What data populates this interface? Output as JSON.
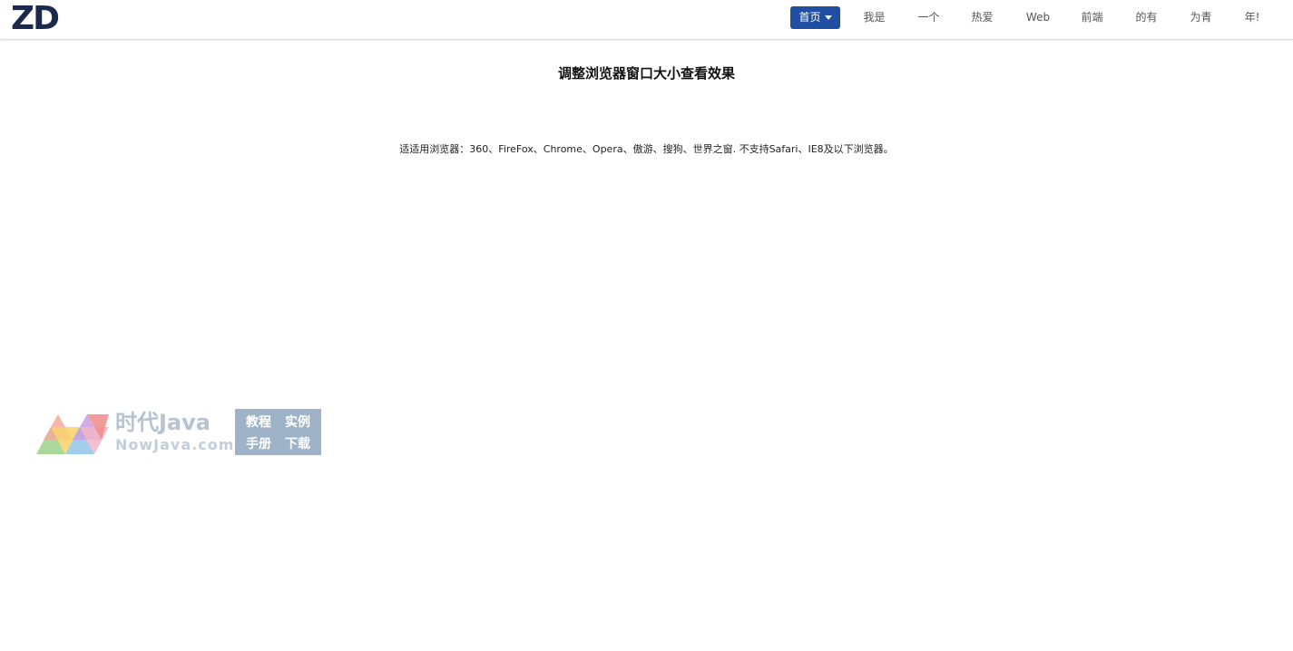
{
  "header": {
    "logo": "ZD",
    "nav": [
      {
        "label": "首页",
        "active": true
      },
      {
        "label": "我是"
      },
      {
        "label": "一个"
      },
      {
        "label": "热爱"
      },
      {
        "label": "Web"
      },
      {
        "label": "前端"
      },
      {
        "label": "的有"
      },
      {
        "label": "为青"
      },
      {
        "label": "年!"
      }
    ],
    "accent_color": "#1f4fa3"
  },
  "main": {
    "title": "调整浏览器窗口大小查看效果",
    "note": "适适用浏览器：360、FireFox、Chrome、Opera、傲游、搜狗、世界之窗. 不支持Safari、IE8及以下浏览器。"
  },
  "watermark": {
    "brand": "时代Java",
    "domain": "NowJava.com",
    "box_items": [
      "教程",
      "实例",
      "手册",
      "下载"
    ]
  }
}
